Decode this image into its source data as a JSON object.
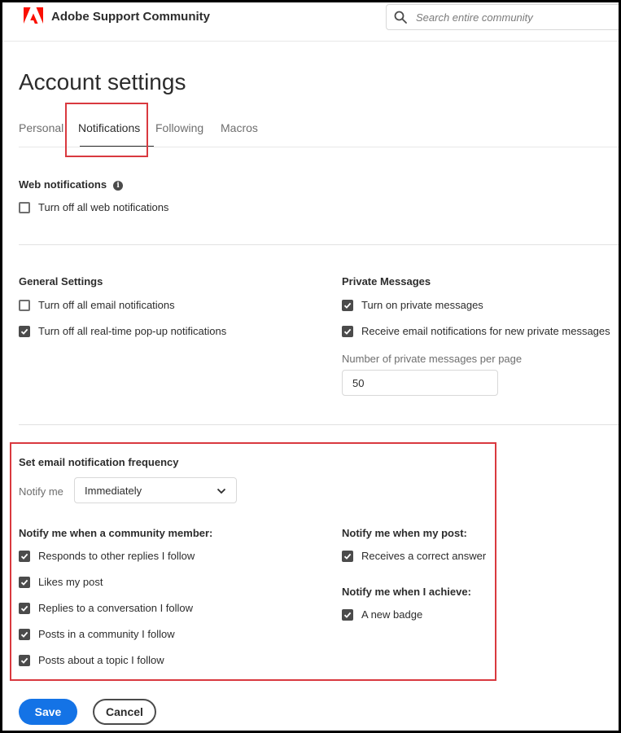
{
  "header": {
    "brand": "Adobe Support Community",
    "logo_icon": "adobe-logo-icon",
    "search_placeholder": "Search entire community",
    "brand_color": "#fa0f00"
  },
  "page_title": "Account settings",
  "tabs": [
    {
      "label": "Personal",
      "active": false
    },
    {
      "label": "Notifications",
      "active": true
    },
    {
      "label": "Following",
      "active": false
    },
    {
      "label": "Macros",
      "active": false
    }
  ],
  "web_notifications": {
    "heading": "Web notifications",
    "items": [
      {
        "label": "Turn off all web notifications",
        "checked": false
      }
    ]
  },
  "general_settings": {
    "heading": "General Settings",
    "items": [
      {
        "label": "Turn off all email notifications",
        "checked": false
      },
      {
        "label": "Turn off all real-time pop-up notifications",
        "checked": true
      }
    ]
  },
  "private_messages": {
    "heading": "Private Messages",
    "items": [
      {
        "label": "Turn on private messages",
        "checked": true
      },
      {
        "label": "Receive email notifications for new private messages",
        "checked": true
      }
    ],
    "per_page_label": "Number of private messages per page",
    "per_page_value": "50"
  },
  "frequency": {
    "heading": "Set email notification frequency",
    "notify_label": "Notify me",
    "notify_value": "Immediately",
    "member": {
      "heading": "Notify me when a community member:",
      "items": [
        {
          "label": "Responds to other replies I follow",
          "checked": true
        },
        {
          "label": "Likes my post",
          "checked": true
        },
        {
          "label": "Replies to a conversation I follow",
          "checked": true
        },
        {
          "label": "Posts in a community I follow",
          "checked": true
        },
        {
          "label": "Posts about a topic I follow",
          "checked": true
        }
      ]
    },
    "my_post": {
      "heading": "Notify me when my post:",
      "items": [
        {
          "label": "Receives a correct answer",
          "checked": true
        }
      ]
    },
    "achieve": {
      "heading": "Notify me when I achieve:",
      "items": [
        {
          "label": "A new badge",
          "checked": true
        }
      ]
    }
  },
  "actions": {
    "save": "Save",
    "cancel": "Cancel",
    "save_color": "#1473e6"
  },
  "highlight_color": "#d9393f"
}
